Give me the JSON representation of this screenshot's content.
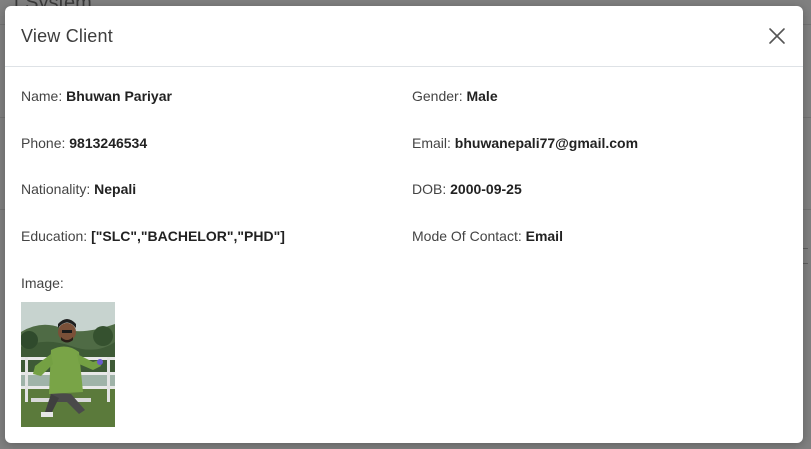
{
  "background": {
    "title": "t System"
  },
  "modal": {
    "title": "View Client",
    "close_icon": "close-icon"
  },
  "client": {
    "name_label": "Name:",
    "name": "Bhuwan Pariyar",
    "gender_label": "Gender:",
    "gender": "Male",
    "phone_label": "Phone:",
    "phone": "9813246534",
    "email_label": "Email:",
    "email": "bhuwanepali77@gmail.com",
    "nationality_label": "Nationality:",
    "nationality": "Nepali",
    "dob_label": "DOB:",
    "dob": "2000-09-25",
    "education_label": "Education:",
    "education": "[\"SLC\",\"BACHELOR\",\"PHD\"]",
    "contact_label": "Mode Of Contact:",
    "contact": "Email",
    "image_label": "Image:"
  },
  "colors": {
    "overlay": "#808080",
    "modal_bg": "#ffffff",
    "divider": "#dee2e6"
  }
}
